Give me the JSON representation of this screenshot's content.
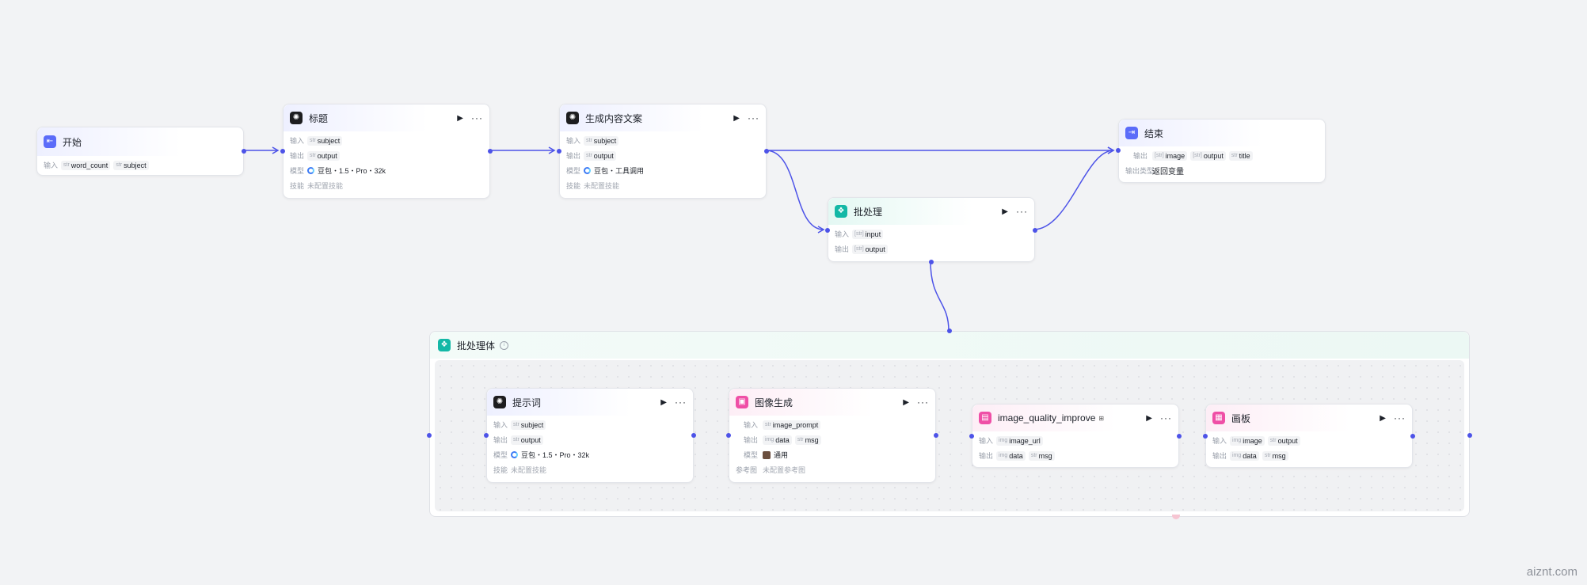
{
  "labels": {
    "input": "输入",
    "output": "输出",
    "model": "模型",
    "skill": "技能",
    "output_type": "输出类型",
    "reference": "参考图",
    "type_str": "str",
    "type_img": "img",
    "type_arr": "[str]"
  },
  "nodes": {
    "start": {
      "title": "开始",
      "inputs": [
        "word_count",
        "subject"
      ]
    },
    "title_node": {
      "title": "标题",
      "input": "subject",
      "output": "output",
      "model": "豆包・1.5・Pro・32k",
      "skill": "未配置技能"
    },
    "content": {
      "title": "生成内容文案",
      "input": "subject",
      "output": "output",
      "model": "豆包・工具调用",
      "skill": "未配置技能"
    },
    "batch": {
      "title": "批处理",
      "input": "input",
      "output": "output"
    },
    "end": {
      "title": "结束",
      "outputs": [
        "image",
        "output",
        "title"
      ],
      "output_type": "返回变量"
    }
  },
  "group": {
    "title": "批处理体",
    "prompt": {
      "title": "提示词",
      "input": "subject",
      "output": "output",
      "model": "豆包・1.5・Pro・32k",
      "skill": "未配置技能"
    },
    "image_gen": {
      "title": "图像生成",
      "input": "image_prompt",
      "outputs": [
        "data",
        "msg"
      ],
      "model": "通用",
      "reference": "未配置参考图"
    },
    "quality": {
      "title": "image_quality_improve",
      "input": "image_url",
      "outputs": [
        "data",
        "msg"
      ]
    },
    "canvas": {
      "title": "画板",
      "inputs": [
        "image",
        "output"
      ],
      "outputs": [
        "data",
        "msg"
      ]
    }
  },
  "colors": {
    "wire": "#4d53e8",
    "accent_blue": "#5b6cf9",
    "teal": "#13b8a6",
    "pink": "#ef4fa6"
  },
  "watermark": "aiznt.com"
}
